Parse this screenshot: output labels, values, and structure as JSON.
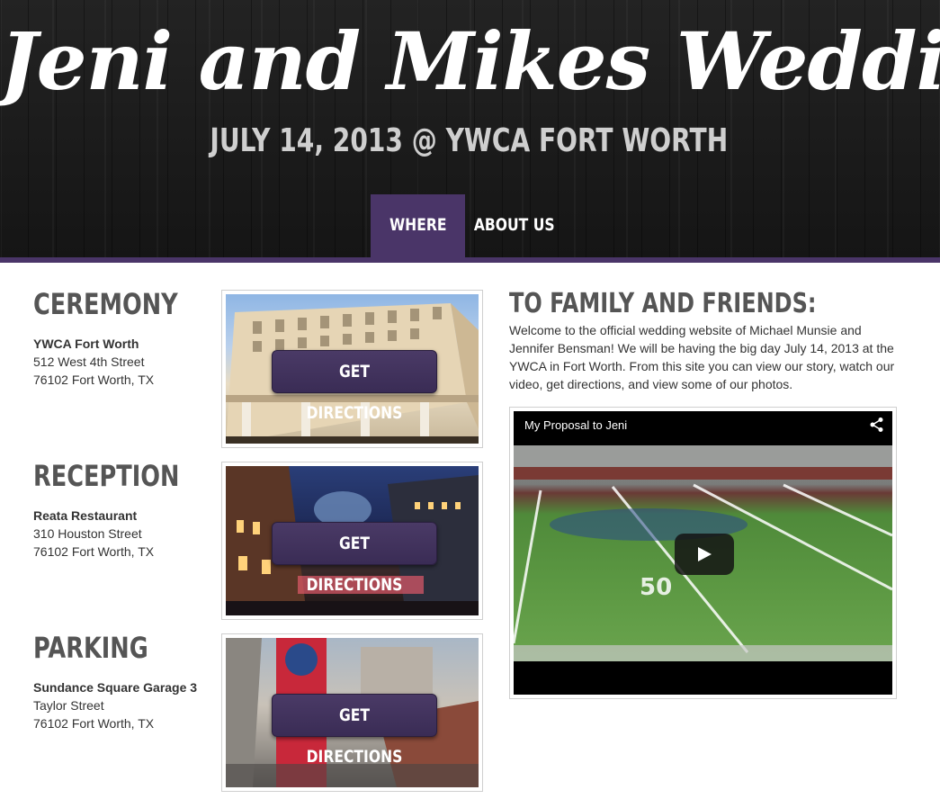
{
  "header": {
    "title": "Jeni and Mikes Wedding",
    "subtitle": "JULY 14, 2013 @ YWCA FORT WORTH",
    "nav": [
      {
        "label": "WHERE",
        "active": true
      },
      {
        "label": "ABOUT US",
        "active": false
      }
    ]
  },
  "locations": [
    {
      "heading": "CEREMONY",
      "name": "YWCA Fort Worth",
      "address": "512 West 4th Street",
      "city": "76102 Fort Worth, TX",
      "button": "GET DIRECTIONS"
    },
    {
      "heading": "RECEPTION",
      "name": "Reata Restaurant",
      "address": "310 Houston Street",
      "city": "76102 Fort Worth, TX",
      "button": "GET DIRECTIONS"
    },
    {
      "heading": "PARKING",
      "name": "Sundance Square Garage 3",
      "address": "Taylor Street",
      "city": "76102 Fort Worth, TX",
      "button": "GET DIRECTIONS"
    }
  ],
  "welcome": {
    "title": "TO FAMILY AND FRIENDS:",
    "text": "Welcome to the official wedding website of Michael Munsie and Jennifer Bensman! We will be having the big day July 14, 2013 at the YWCA in Fort Worth. From this site you can view our story, watch our video, get directions, and view some of our photos."
  },
  "video": {
    "title": "My Proposal to Jeni",
    "field_number": "50"
  },
  "colors": {
    "accent": "#4a3568",
    "header_bg": "#1c1c1c",
    "button_bg": "#3f3059"
  }
}
